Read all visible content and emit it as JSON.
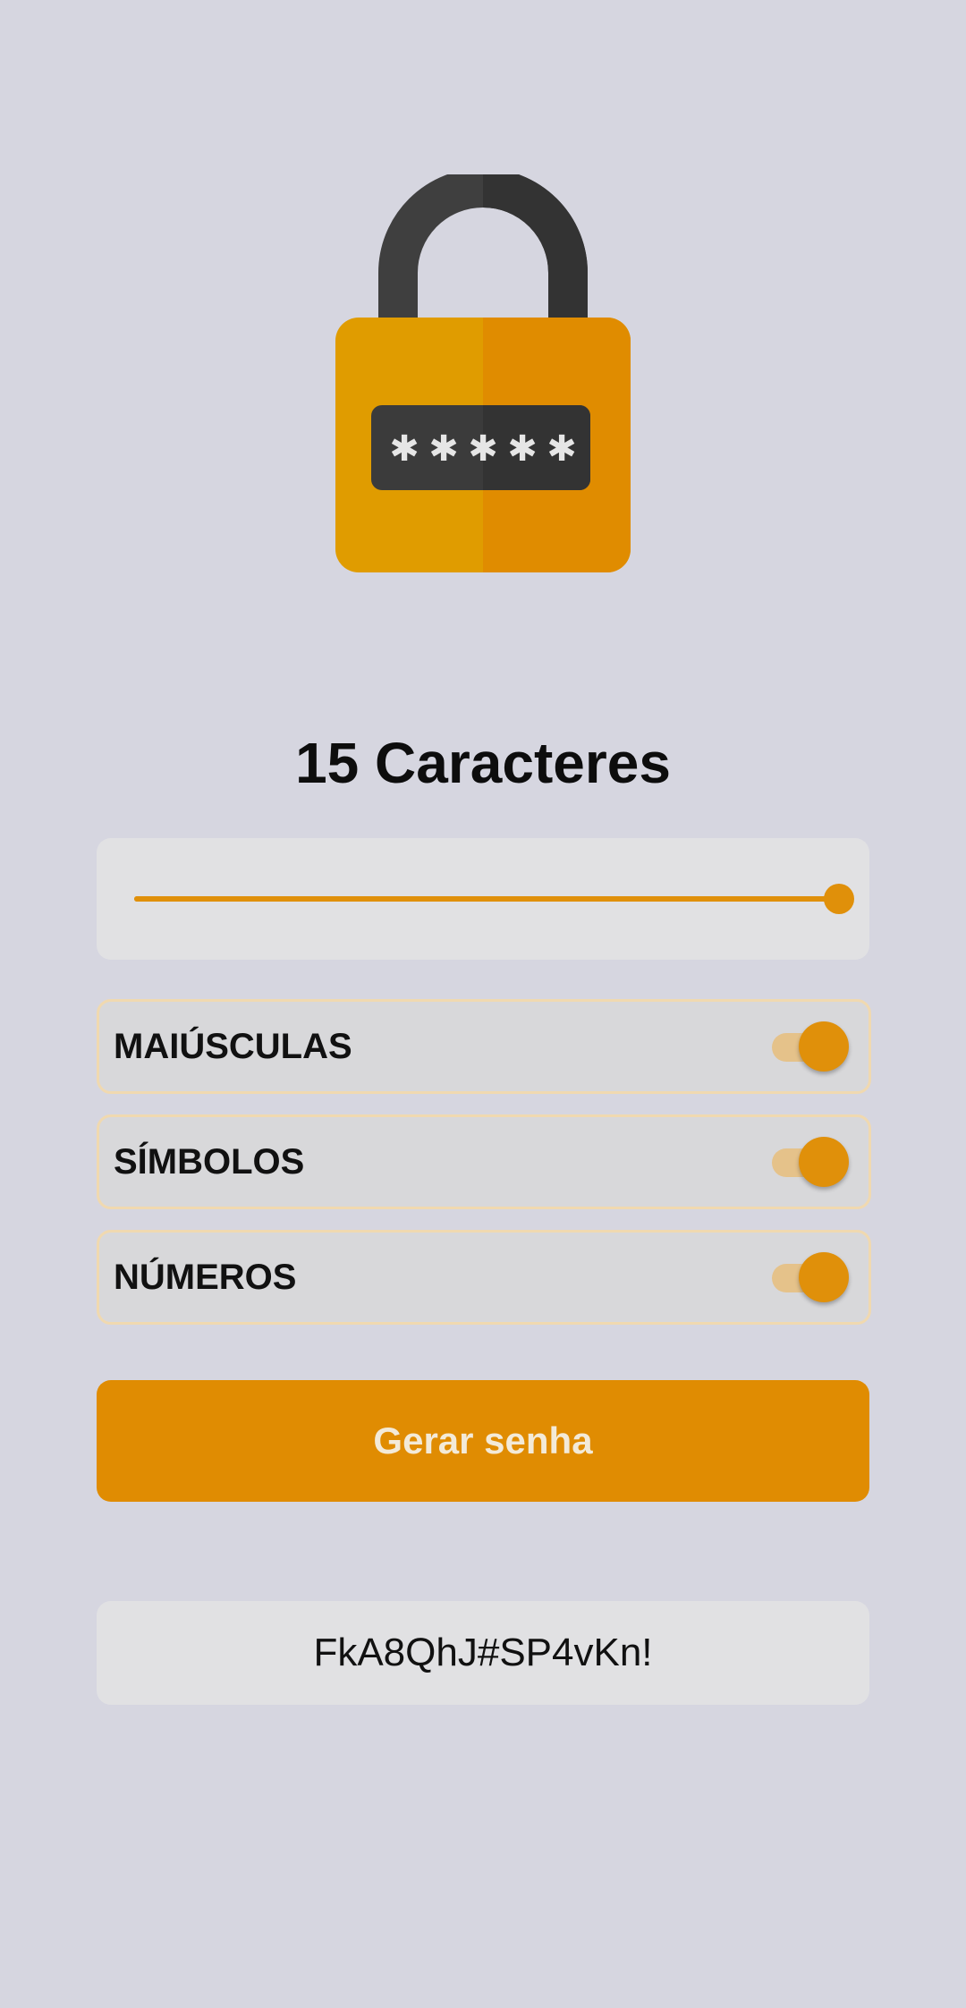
{
  "length": {
    "title": "15 Caracteres",
    "value": 15,
    "max": 15,
    "fill_fraction": 1.0
  },
  "options": [
    {
      "label": "MAIÚSCULAS",
      "enabled": true
    },
    {
      "label": "SÍMBOLOS",
      "enabled": true
    },
    {
      "label": "NÚMEROS",
      "enabled": true
    }
  ],
  "generate_button": {
    "label": "Gerar senha"
  },
  "result": {
    "password": "FkA8QhJ#SP4vKn!"
  },
  "colors": {
    "accent": "#e0900a",
    "background": "#d6d6e0",
    "card": "#e1e1e3"
  },
  "icons": {
    "hero": "padlock-icon"
  }
}
